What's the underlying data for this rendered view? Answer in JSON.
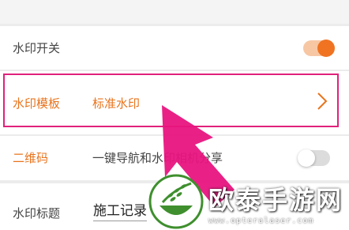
{
  "settings": {
    "watermark_switch": {
      "label": "水印开关",
      "enabled": true
    },
    "template": {
      "label": "水印模板",
      "value": "标准水印"
    },
    "qr_code": {
      "label": "二维码",
      "description": "一键导航和水印相机分享",
      "enabled": false
    },
    "title": {
      "label": "水印标题",
      "value": "施工记录"
    }
  },
  "watermark_logo": {
    "text": "欧泰手游网",
    "url": "www.opteralaser.com"
  },
  "colors": {
    "accent": "#f07322",
    "highlight": "#e0217b",
    "logo_green": "#3f8f2e"
  },
  "icons": {
    "chevron": "chevron-right-icon",
    "pointer": "arrow-pointer-icon",
    "logo": "wheat-bowl-logo-icon"
  }
}
